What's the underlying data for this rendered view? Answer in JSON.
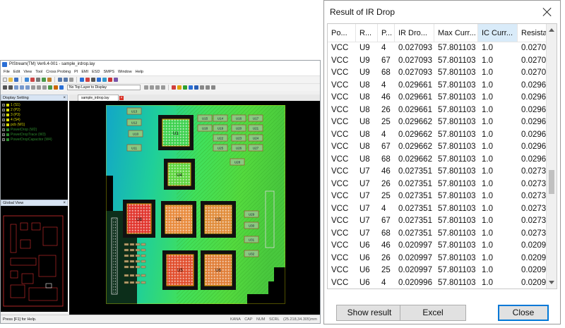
{
  "app": {
    "title": "PIStream(TM) Ver6.4-001 - sample_irdrop.lay",
    "menu": [
      "File",
      "Edit",
      "View",
      "Tool",
      "Cross Probing",
      "PI",
      "EMI",
      "ESD",
      "SMPS",
      "Window",
      "Help"
    ],
    "layer_select": "No Top Layer to Display",
    "display_setting": {
      "title": "Display Setting",
      "layers": [
        {
          "label": "1 (S1)",
          "color": "#d8d800"
        },
        {
          "label": "2 (P2)",
          "color": "#d8d800"
        },
        {
          "label": "3 (P3)",
          "color": "#d8d800"
        },
        {
          "label": "4 (S4)",
          "color": "#d8d800"
        },
        {
          "label": "pcb (W1)",
          "color": "#d8d800"
        },
        {
          "label": "PowerDrop (W2)",
          "color": "#2d8a2d"
        },
        {
          "label": "PowerDropTrace (W3)",
          "color": "#2d8a2d"
        },
        {
          "label": "PowerDropCapacitor (W4)",
          "color": "#2d8a2d"
        }
      ]
    },
    "global_view": {
      "title": "Global View"
    },
    "doc_tab": "sample_irdrop.lay",
    "status": {
      "left": "Press [F1] for Help.",
      "indicators": [
        "KANA",
        "CAP",
        "NUM",
        "SCRL"
      ],
      "coords": "(25.218,34.305)mm"
    },
    "board": {
      "caps": [
        "U13",
        "U12",
        "U10",
        "U11",
        "U15",
        "U14",
        "U16",
        "U17",
        "U18",
        "U19",
        "U20",
        "U21",
        "U22",
        "U23",
        "U24",
        "U25",
        "U26",
        "U27",
        "U28",
        "U29",
        "U30",
        "U31",
        "U32"
      ],
      "chips": [
        {
          "label": "U1",
          "heat": "green"
        },
        {
          "label": "U4",
          "heat": "green"
        },
        {
          "label": "U8",
          "heat": "red"
        },
        {
          "label": "U2",
          "heat": "orange"
        },
        {
          "label": "U3",
          "heat": "orange"
        },
        {
          "label": "U5",
          "heat": "red"
        },
        {
          "label": "U6",
          "heat": "orange"
        }
      ]
    },
    "colors": {
      "ir_low": "#1030d0",
      "ir_mid": "#30e060",
      "ir_high": "#e03020",
      "pad": "#c06040"
    }
  },
  "dialog": {
    "title": "Result of IR Drop",
    "columns": [
      "Po...",
      "R...",
      "P...",
      "IR Dro...",
      "Max Curr...",
      "IC Curr...",
      "Resista"
    ],
    "selected_column": 5,
    "rows": [
      [
        "VCC",
        "U9",
        "4",
        "0.027093",
        "57.801103",
        "1.0",
        "0.0270"
      ],
      [
        "VCC",
        "U9",
        "67",
        "0.027093",
        "57.801103",
        "1.0",
        "0.0270"
      ],
      [
        "VCC",
        "U9",
        "68",
        "0.027093",
        "57.801103",
        "1.0",
        "0.0270"
      ],
      [
        "VCC",
        "U8",
        "4",
        "0.029661",
        "57.801103",
        "1.0",
        "0.0296"
      ],
      [
        "VCC",
        "U8",
        "46",
        "0.029661",
        "57.801103",
        "1.0",
        "0.0296"
      ],
      [
        "VCC",
        "U8",
        "26",
        "0.029661",
        "57.801103",
        "1.0",
        "0.0296"
      ],
      [
        "VCC",
        "U8",
        "25",
        "0.029662",
        "57.801103",
        "1.0",
        "0.0296"
      ],
      [
        "VCC",
        "U8",
        "4",
        "0.029662",
        "57.801103",
        "1.0",
        "0.0296"
      ],
      [
        "VCC",
        "U8",
        "67",
        "0.029662",
        "57.801103",
        "1.0",
        "0.0296"
      ],
      [
        "VCC",
        "U8",
        "68",
        "0.029662",
        "57.801103",
        "1.0",
        "0.0296"
      ],
      [
        "VCC",
        "U7",
        "46",
        "0.027351",
        "57.801103",
        "1.0",
        "0.0273"
      ],
      [
        "VCC",
        "U7",
        "26",
        "0.027351",
        "57.801103",
        "1.0",
        "0.0273"
      ],
      [
        "VCC",
        "U7",
        "25",
        "0.027351",
        "57.801103",
        "1.0",
        "0.0273"
      ],
      [
        "VCC",
        "U7",
        "4",
        "0.027351",
        "57.801103",
        "1.0",
        "0.0273"
      ],
      [
        "VCC",
        "U7",
        "67",
        "0.027351",
        "57.801103",
        "1.0",
        "0.0273"
      ],
      [
        "VCC",
        "U7",
        "68",
        "0.027351",
        "57.801103",
        "1.0",
        "0.0273"
      ],
      [
        "VCC",
        "U6",
        "46",
        "0.020997",
        "57.801103",
        "1.0",
        "0.0209"
      ],
      [
        "VCC",
        "U6",
        "26",
        "0.020997",
        "57.801103",
        "1.0",
        "0.0209"
      ],
      [
        "VCC",
        "U6",
        "25",
        "0.020997",
        "57.801103",
        "1.0",
        "0.0209"
      ],
      [
        "VCC",
        "U6",
        "4",
        "0.020996",
        "57.801103",
        "1.0",
        "0.0209"
      ]
    ],
    "scroll_position": 0.62,
    "buttons": {
      "show": "Show result",
      "excel": "Excel",
      "close": "Close"
    }
  }
}
